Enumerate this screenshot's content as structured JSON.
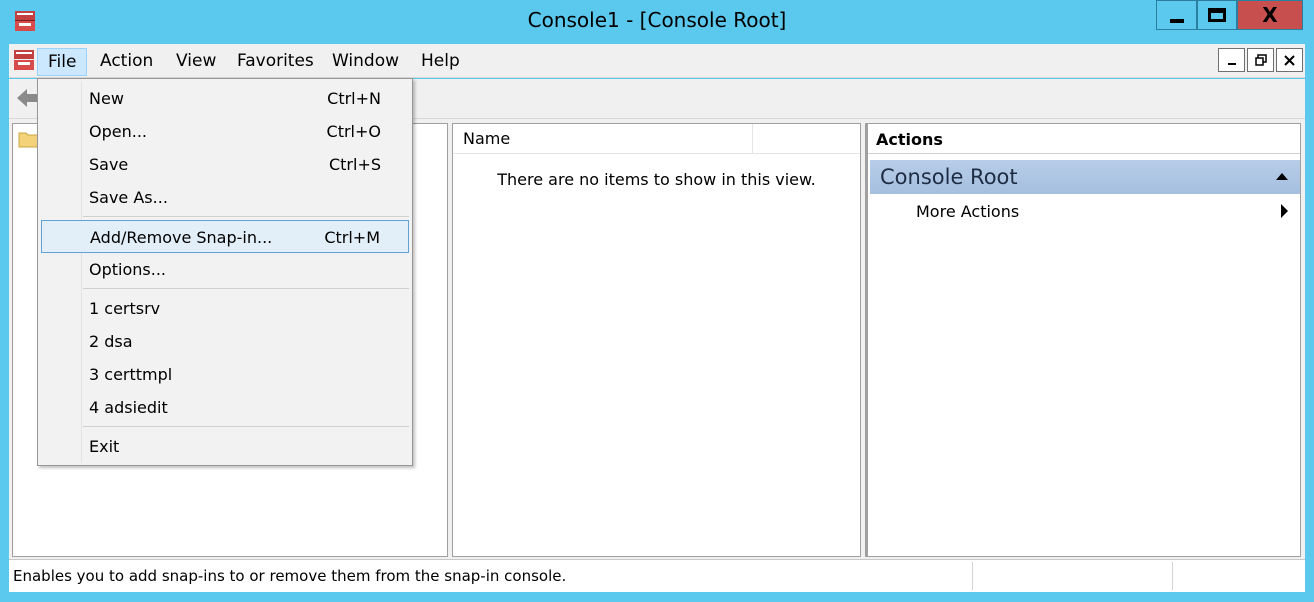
{
  "window": {
    "title": "Console1 - [Console Root]",
    "close_glyph": "X"
  },
  "menubar": {
    "items": [
      "File",
      "Action",
      "View",
      "Favorites",
      "Window",
      "Help"
    ],
    "active": "File"
  },
  "file_menu": {
    "items": [
      {
        "label": "New",
        "shortcut": "Ctrl+N"
      },
      {
        "label": "Open...",
        "shortcut": "Ctrl+O"
      },
      {
        "label": "Save",
        "shortcut": "Ctrl+S"
      },
      {
        "label": "Save As...",
        "shortcut": ""
      },
      {
        "label": "Add/Remove Snap-in...",
        "shortcut": "Ctrl+M",
        "highlighted": true
      },
      {
        "label": "Options...",
        "shortcut": ""
      },
      {
        "label": "1 certsrv",
        "shortcut": ""
      },
      {
        "label": "2 dsa",
        "shortcut": ""
      },
      {
        "label": "3 certtmpl",
        "shortcut": ""
      },
      {
        "label": "4 adsiedit",
        "shortcut": ""
      },
      {
        "label": "Exit",
        "shortcut": ""
      }
    ]
  },
  "list": {
    "column_name": "Name",
    "empty_message": "There are no items to show in this view."
  },
  "actions": {
    "title": "Actions",
    "section": "Console Root",
    "more_actions": "More Actions"
  },
  "status": {
    "text": "Enables you to add snap-ins to or remove them from the snap-in console."
  },
  "colors": {
    "titlebar": "#5bc8ee",
    "close_button": "#c7504f",
    "highlight": "#e3eff8",
    "actions_header": "#b7cde8"
  }
}
